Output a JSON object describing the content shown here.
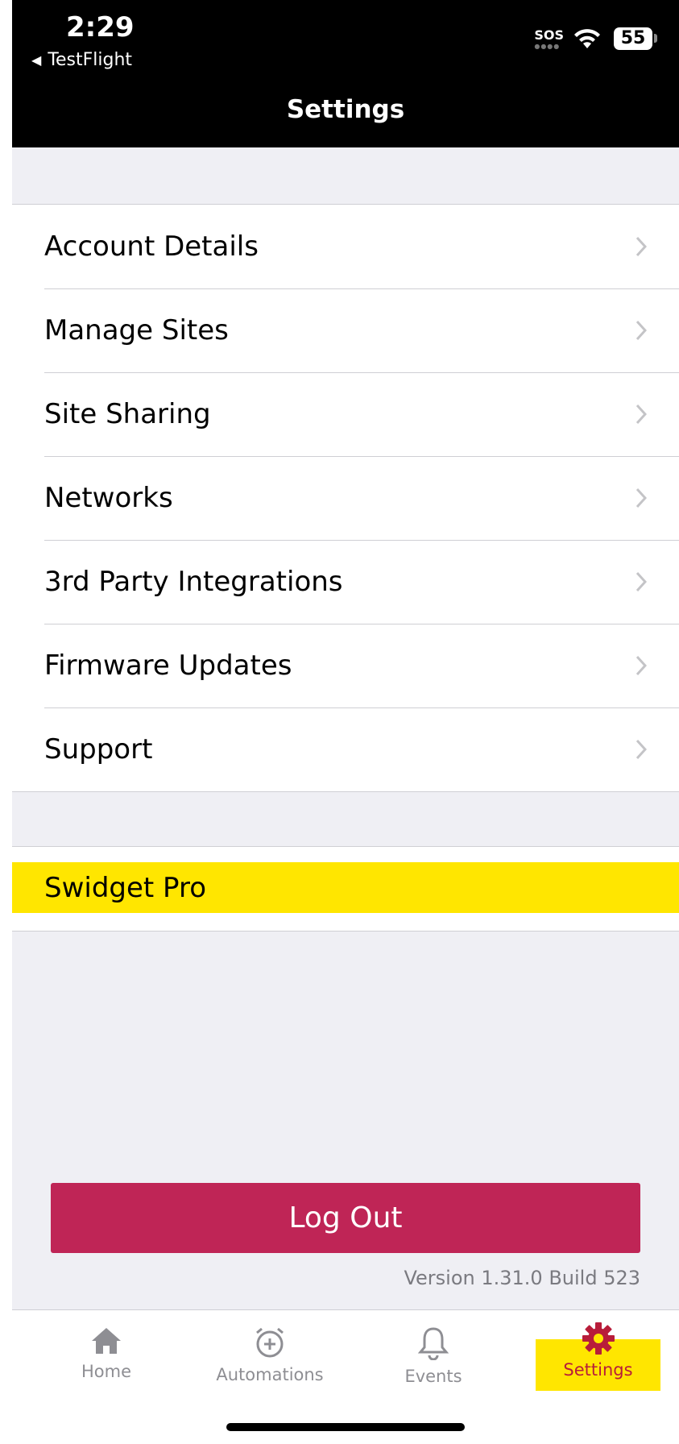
{
  "status_bar": {
    "time": "2:29",
    "back_app": "TestFlight",
    "sos": "SOS",
    "battery": "55"
  },
  "header": {
    "title": "Settings"
  },
  "settings": {
    "items": [
      {
        "label": "Account Details"
      },
      {
        "label": "Manage Sites"
      },
      {
        "label": "Site Sharing"
      },
      {
        "label": "Networks"
      },
      {
        "label": "3rd Party Integrations"
      },
      {
        "label": "Firmware Updates"
      },
      {
        "label": "Support"
      }
    ]
  },
  "pro": {
    "label": "Swidget Pro",
    "color": "#ffe600"
  },
  "logout": {
    "label": "Log Out",
    "color": "#bf2556"
  },
  "version": "Version 1.31.0 Build 523",
  "tabbar": {
    "tabs": [
      {
        "label": "Home",
        "icon": "home-icon"
      },
      {
        "label": "Automations",
        "icon": "alarm-add-icon"
      },
      {
        "label": "Events",
        "icon": "bell-icon"
      },
      {
        "label": "Settings",
        "icon": "gear-icon",
        "active": true
      }
    ]
  }
}
